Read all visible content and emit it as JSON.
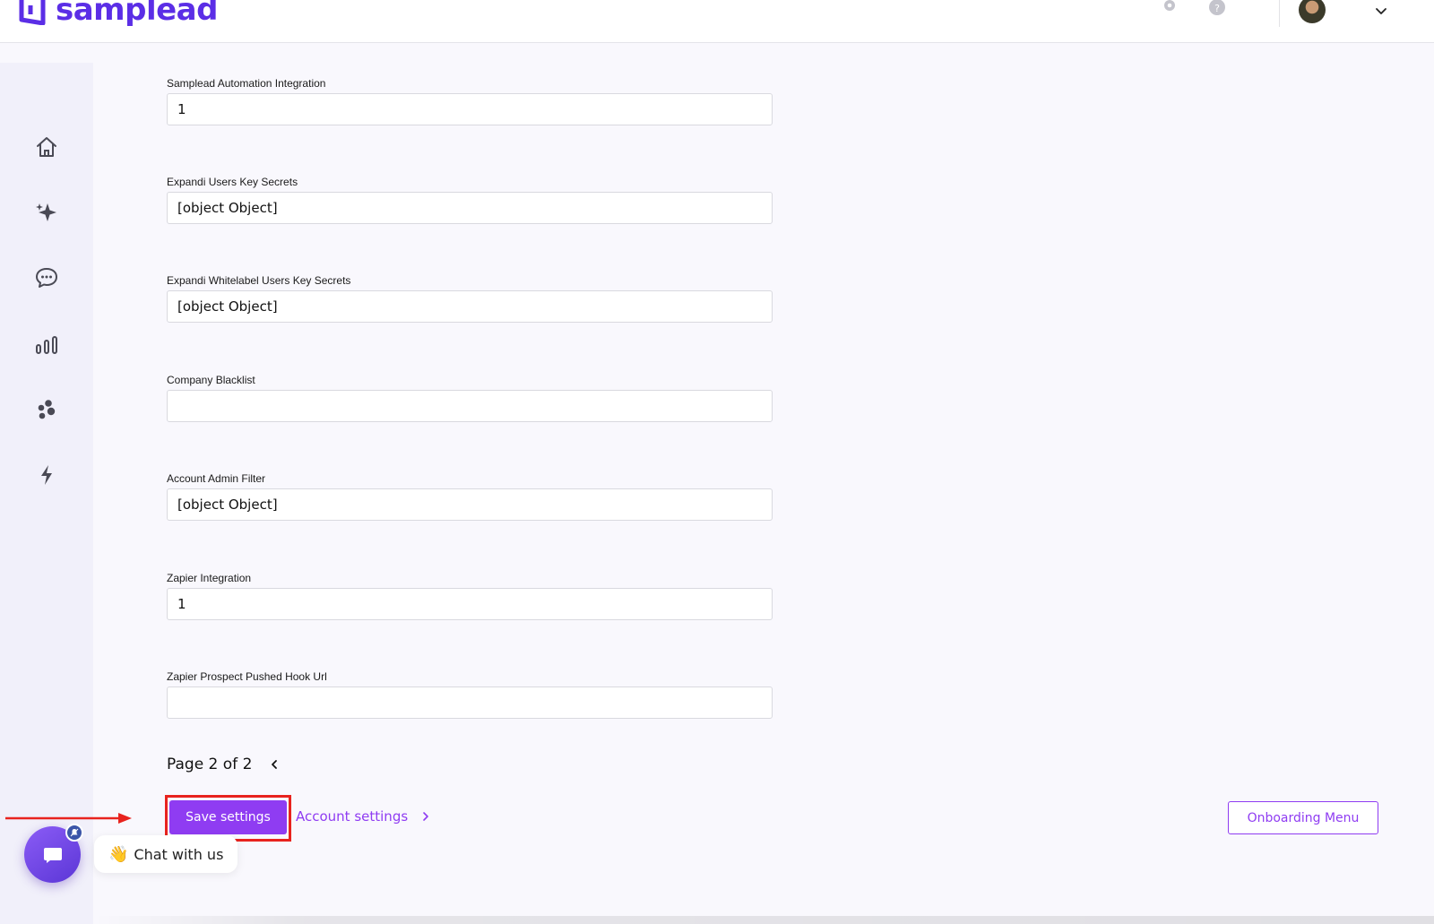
{
  "header": {
    "logo_text": "samplead",
    "brand_color": "#5b2ee6",
    "icons": [
      "gear-icon",
      "help-icon",
      "avatar",
      "chevron-down-icon"
    ]
  },
  "sidebar": {
    "items": [
      {
        "name": "home",
        "icon": "home-icon"
      },
      {
        "name": "ai",
        "icon": "sparkles-icon"
      },
      {
        "name": "messages",
        "icon": "chat-icon"
      },
      {
        "name": "analytics",
        "icon": "bar-chart-icon"
      },
      {
        "name": "integrations",
        "icon": "dots-cluster-icon"
      },
      {
        "name": "automation",
        "icon": "lightning-icon"
      }
    ]
  },
  "form": {
    "fields": [
      {
        "label": "Samplead Automation Integration",
        "value": "1"
      },
      {
        "label": "Expandi Users Key Secrets",
        "value": "[object Object]"
      },
      {
        "label": "Expandi Whitelabel Users Key Secrets",
        "value": "[object Object]"
      },
      {
        "label": "Company Blacklist",
        "value": ""
      },
      {
        "label": "Account Admin Filter",
        "value": "[object Object]"
      },
      {
        "label": "Zapier Integration",
        "value": "1"
      },
      {
        "label": "Zapier Prospect Pushed Hook Url",
        "value": ""
      }
    ],
    "pager": "Page 2 of 2",
    "save_label": "Save settings",
    "account_link_label": "Account settings",
    "onboarding_label": "Onboarding Menu",
    "accent_color": "#8f3cf2"
  },
  "chat": {
    "wave": "👋",
    "label": "Chat with us"
  },
  "annotation": {
    "highlight_color": "#e8231e"
  }
}
